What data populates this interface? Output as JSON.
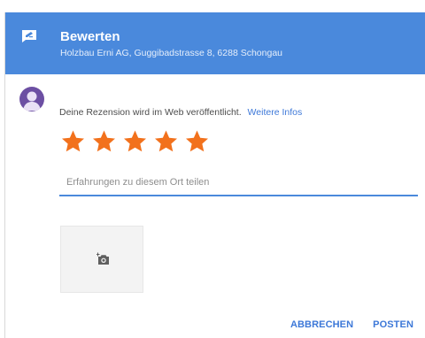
{
  "header": {
    "title": "Bewerten",
    "subtitle": "Holzbau Erni AG, Guggibadstrasse 8, 6288 Schongau",
    "icon": "rating-icon",
    "background_color": "#4a89dc"
  },
  "avatar": {
    "icon": "user-avatar-icon",
    "color": "#6c4fa3"
  },
  "notice": {
    "text": "Deine Rezension wird im Web veröffentlicht.",
    "link_label": "Weitere Infos"
  },
  "rating": {
    "value": 5,
    "max": 5,
    "star_color": "#f2711c"
  },
  "review": {
    "placeholder": "Erfahrungen zu diesem Ort teilen",
    "value": ""
  },
  "photo": {
    "icon": "add-photo-icon"
  },
  "actions": {
    "cancel_label": "ABBRECHEN",
    "post_label": "POSTEN"
  }
}
